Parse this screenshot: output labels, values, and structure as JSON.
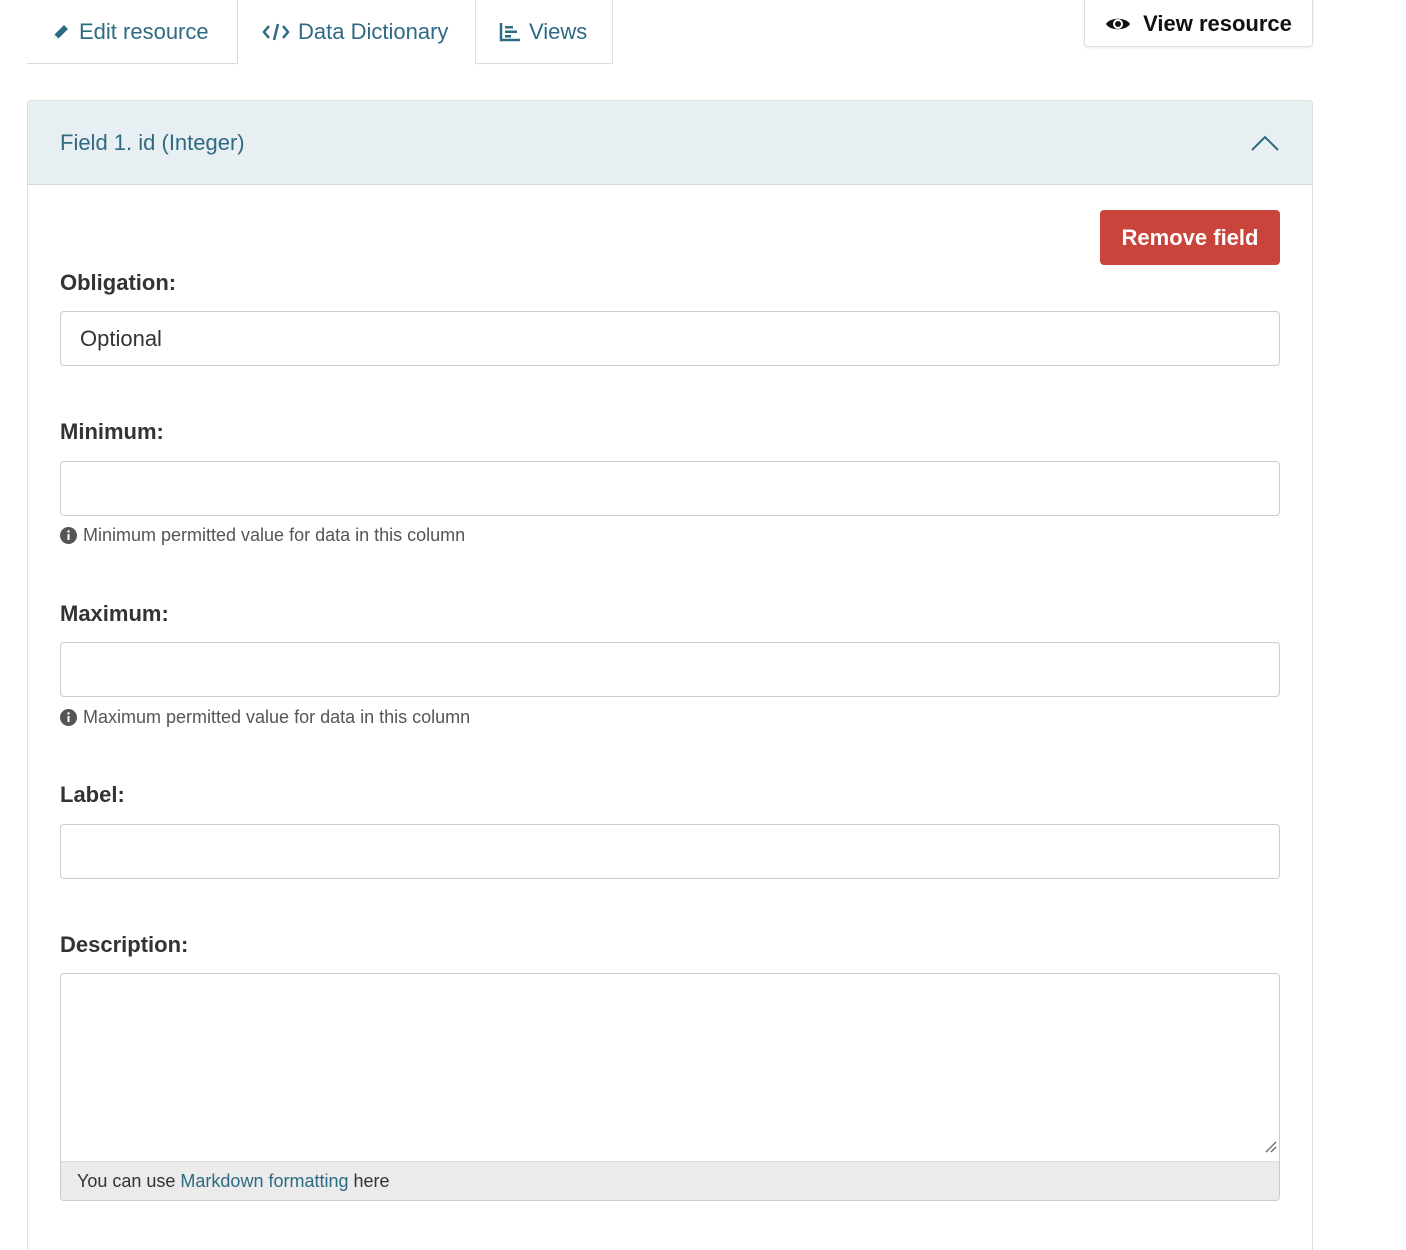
{
  "tabs": [
    {
      "label": "Edit resource",
      "icon": "pencil-icon"
    },
    {
      "label": "Data Dictionary",
      "icon": "code-icon"
    },
    {
      "label": "Views",
      "icon": "chart-icon"
    }
  ],
  "view_resource": {
    "label": "View resource",
    "icon": "eye-icon"
  },
  "field": {
    "title": "Field 1. id (Integer)",
    "remove_label": "Remove field",
    "obligation": {
      "label": "Obligation:",
      "value": "Optional"
    },
    "minimum": {
      "label": "Minimum:",
      "value": "",
      "help": "Minimum permitted value for data in this column"
    },
    "maximum": {
      "label": "Maximum:",
      "value": "",
      "help": "Maximum permitted value for data in this column"
    },
    "label_field": {
      "label": "Label:",
      "value": ""
    },
    "description": {
      "label": "Description:",
      "value": "",
      "markdown_prefix": "You can use",
      "markdown_link": "Markdown formatting",
      "markdown_suffix": "here"
    }
  },
  "colors": {
    "link": "#2e6a83",
    "danger": "#c9443b",
    "panel_header": "#e8eff3"
  }
}
